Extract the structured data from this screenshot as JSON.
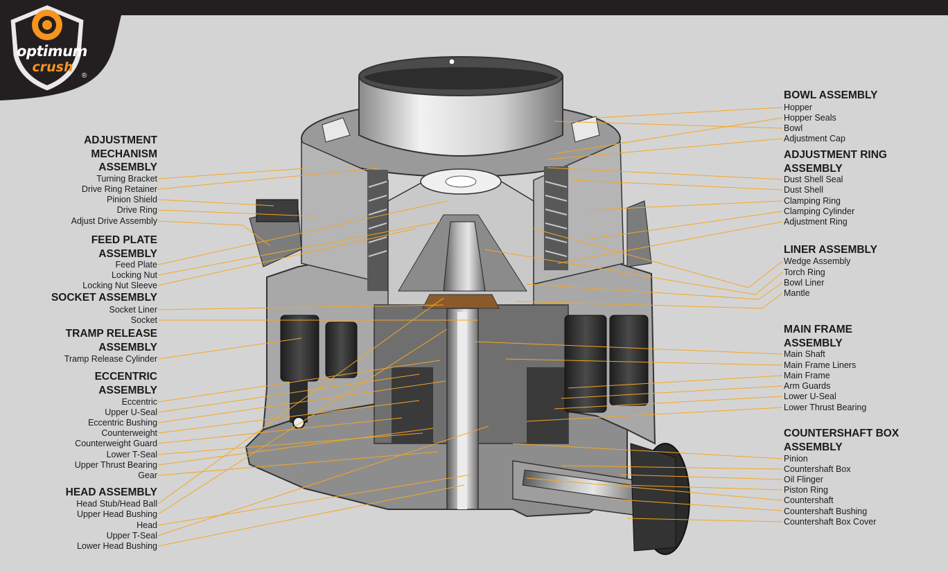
{
  "brand": {
    "logo_top": "optimum",
    "logo_bottom": "crush",
    "registered": "®"
  },
  "left_groups": [
    {
      "id": "adjustment-mechanism",
      "title": [
        "ADJUSTMENT",
        "MECHANISM",
        "ASSEMBLY"
      ],
      "items": [
        "Turning Bracket",
        "Drive Ring Retainer",
        "Pinion Shield",
        "Drive Ring",
        "Adjust Drive Assembly"
      ]
    },
    {
      "id": "feed-plate",
      "title": [
        "FEED PLATE",
        "ASSEMBLY"
      ],
      "items": [
        "Feed Plate",
        "Locking Nut",
        "Locking Nut Sleeve"
      ]
    },
    {
      "id": "socket",
      "title": [
        "SOCKET ASSEMBLY"
      ],
      "items": [
        "Socket Liner",
        "Socket"
      ]
    },
    {
      "id": "tramp-release",
      "title": [
        "TRAMP RELEASE",
        "ASSEMBLY"
      ],
      "items": [
        "Tramp Release Cylinder"
      ]
    },
    {
      "id": "eccentric",
      "title": [
        "ECCENTRIC",
        "ASSEMBLY"
      ],
      "items": [
        "Eccentric",
        "Upper U-Seal",
        "Eccentric Bushing",
        "Counterweight",
        "Counterweight Guard",
        "Lower T-Seal",
        "Upper Thrust Bearing",
        "Gear"
      ]
    },
    {
      "id": "head",
      "title": [
        "HEAD ASSEMBLY"
      ],
      "items": [
        "Head Stub/Head Ball",
        "Upper Head Bushing",
        "Head",
        "Upper T-Seal",
        "Lower Head Bushing"
      ]
    }
  ],
  "right_groups": [
    {
      "id": "bowl",
      "title": [
        "BOWL ASSEMBLY"
      ],
      "items": [
        "Hopper",
        "Hopper Seals",
        "Bowl",
        "Adjustment Cap"
      ]
    },
    {
      "id": "adjustment-ring",
      "title": [
        "ADJUSTMENT RING",
        "ASSEMBLY"
      ],
      "items": [
        "Dust Shell Seal",
        "Dust Shell",
        "Clamping Ring",
        "Clamping Cylinder",
        "Adjustment Ring"
      ]
    },
    {
      "id": "liner",
      "title": [
        "LINER ASSEMBLY"
      ],
      "items": [
        "Wedge Assembly",
        "Torch Ring",
        "Bowl Liner",
        "Mantle"
      ]
    },
    {
      "id": "main-frame",
      "title": [
        "MAIN FRAME",
        "ASSEMBLY"
      ],
      "items": [
        "Main Shaft",
        "Main Frame Liners",
        "Main Frame",
        "Arm Guards",
        "Lower U-Seal",
        "Lower Thrust Bearing"
      ]
    },
    {
      "id": "countershaft-box",
      "title": [
        "COUNTERSHAFT BOX",
        "ASSEMBLY"
      ],
      "items": [
        "Pinion",
        "Countershaft Box",
        "Oil Flinger",
        "Piston Ring",
        "Countershaft",
        "Countershaft Bushing",
        "Countershaft Box Cover"
      ]
    }
  ],
  "colors": {
    "background": "#d4d4d4",
    "leader_line": "#f5a623",
    "brand_orange": "#f7941d",
    "dark": "#231f20"
  }
}
